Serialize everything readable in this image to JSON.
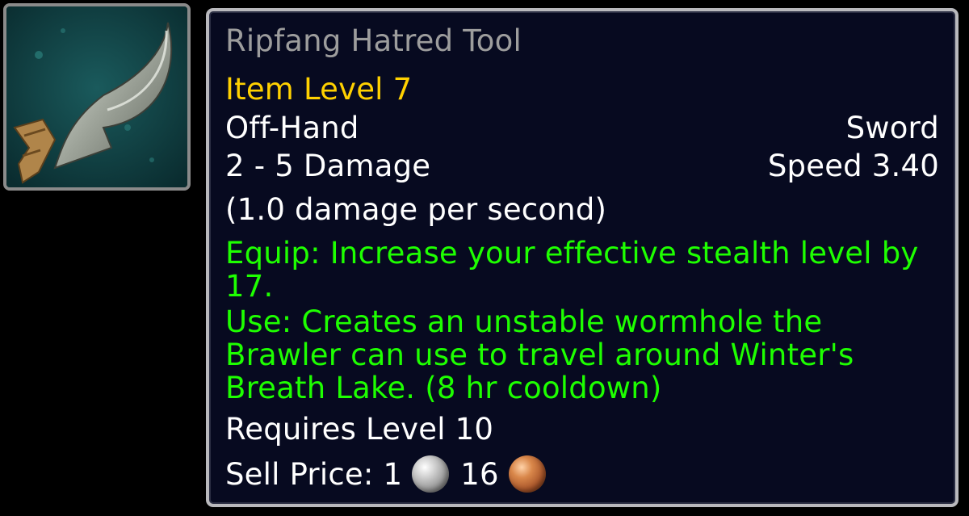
{
  "item": {
    "name": "Ripfang Hatred Tool",
    "item_level": "Item Level 7",
    "slot": "Off-Hand",
    "weapon_type": "Sword",
    "damage": "2 - 5 Damage",
    "speed": "Speed 3.40",
    "dps": "(1.0 damage per second)",
    "equip_effect": "Equip: Increase your effective stealth level by 17.",
    "use_effect": "Use: Creates an unstable wormhole the Brawler can use to travel around Winter's Breath Lake. (8 hr cooldown)",
    "requirement": "Requires Level 10",
    "sell_price": {
      "label": "Sell Price:",
      "silver": "1",
      "copper": "16",
      "silver_icon": "silver-coin-icon",
      "copper_icon": "copper-coin-icon"
    },
    "icon": "curved-dagger-icon"
  },
  "colors": {
    "name_poor": "#9d9d9d",
    "item_level": "#ffd100",
    "text": "#ffffff",
    "effect": "#1eff00",
    "tooltip_bg": "#070a20",
    "border": "#b9b9bd"
  }
}
